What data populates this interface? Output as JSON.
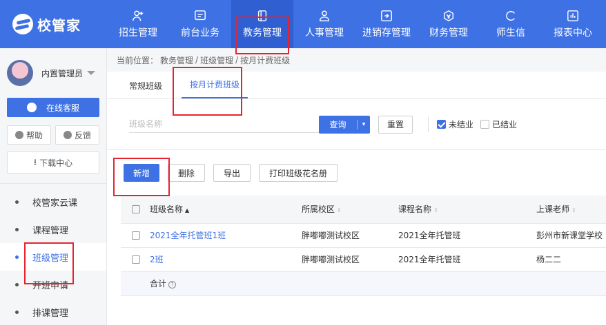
{
  "brand": {
    "name": "校管家"
  },
  "nav": [
    {
      "label": "招生管理",
      "icon": "person-add-icon"
    },
    {
      "label": "前台业务",
      "icon": "monitor-icon"
    },
    {
      "label": "教务管理",
      "icon": "book-icon"
    },
    {
      "label": "人事管理",
      "icon": "person-icon"
    },
    {
      "label": "进销存管理",
      "icon": "inventory-icon"
    },
    {
      "label": "财务管理",
      "icon": "finance-icon"
    },
    {
      "label": "师生信",
      "icon": "chat-icon"
    },
    {
      "label": "报表中心",
      "icon": "report-icon"
    }
  ],
  "nav_active": "教务管理",
  "sidebar": {
    "user_name": "内置管理员",
    "service_label": "在线客服",
    "help_label": "帮助",
    "feedback_label": "反馈",
    "download_label": "下载中心",
    "menu": [
      "校管家云课",
      "课程管理",
      "班级管理",
      "开班申请",
      "排课管理"
    ],
    "menu_active": "班级管理"
  },
  "breadcrumb": {
    "prefix": "当前位置：",
    "path": [
      "教务管理",
      "班级管理",
      "按月计费班级"
    ],
    "sep": "/"
  },
  "tabs": [
    "常规班级",
    "按月计费班级"
  ],
  "tab_active": "按月计费班级",
  "filter": {
    "class_name_placeholder": "班级名称",
    "query_label": "查询",
    "reset_label": "重置",
    "checkbox_unfinished": "未结业",
    "checkbox_finished": "已结业",
    "unfinished_checked": true,
    "finished_checked": false
  },
  "actions": {
    "add": "新增",
    "delete": "删除",
    "export": "导出",
    "print": "打印班级花名册"
  },
  "table": {
    "columns": [
      "班级名称",
      "所属校区",
      "课程名称",
      "上课老师"
    ],
    "rows": [
      [
        "2021全年托管班1班",
        "胖嘟嘟测试校区",
        "2021全年托管班",
        "彭州市新课堂学校"
      ],
      [
        "2班",
        "胖嘟嘟测试校区",
        "2021全年托管班",
        "杨二二"
      ]
    ],
    "total_label": "合计",
    "total_help": "?"
  },
  "colors": {
    "primary": "#3e71e4",
    "highlight": "#e8232f"
  }
}
